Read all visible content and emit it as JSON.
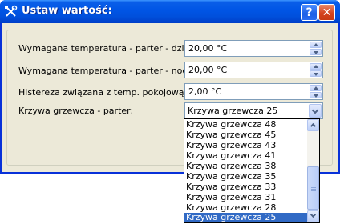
{
  "window": {
    "title": "Ustaw wartość:",
    "title_icon": "wrench-screwdriver-icon",
    "help_label": "?",
    "close_label": "✕"
  },
  "form": {
    "fields": [
      {
        "label": "Wymagana temperatura - parter - dzień:",
        "value": "20,00 °C"
      },
      {
        "label": "Wymagana temperatura - parter - noc:",
        "value": "20,00 °C"
      },
      {
        "label": "Histereza związana z temp. pokojową:",
        "value": "2,00 °C"
      }
    ],
    "curve": {
      "label": "Krzywa grzewcza - parter:",
      "selected": "Krzywa grzewcza 25",
      "options": [
        "Krzywa grzewcza 48",
        "Krzywa grzewcza 45",
        "Krzywa grzewcza 43",
        "Krzywa grzewcza 41",
        "Krzywa grzewcza 38",
        "Krzywa grzewcza 35",
        "Krzywa grzewcza 33",
        "Krzywa grzewcza 31",
        "Krzywa grzewcza 28",
        "Krzywa grzewcza 25"
      ]
    }
  },
  "colors": {
    "titlebar": "#0055e5",
    "dialog_bg": "#ece9d8",
    "selection": "#316ac5"
  }
}
